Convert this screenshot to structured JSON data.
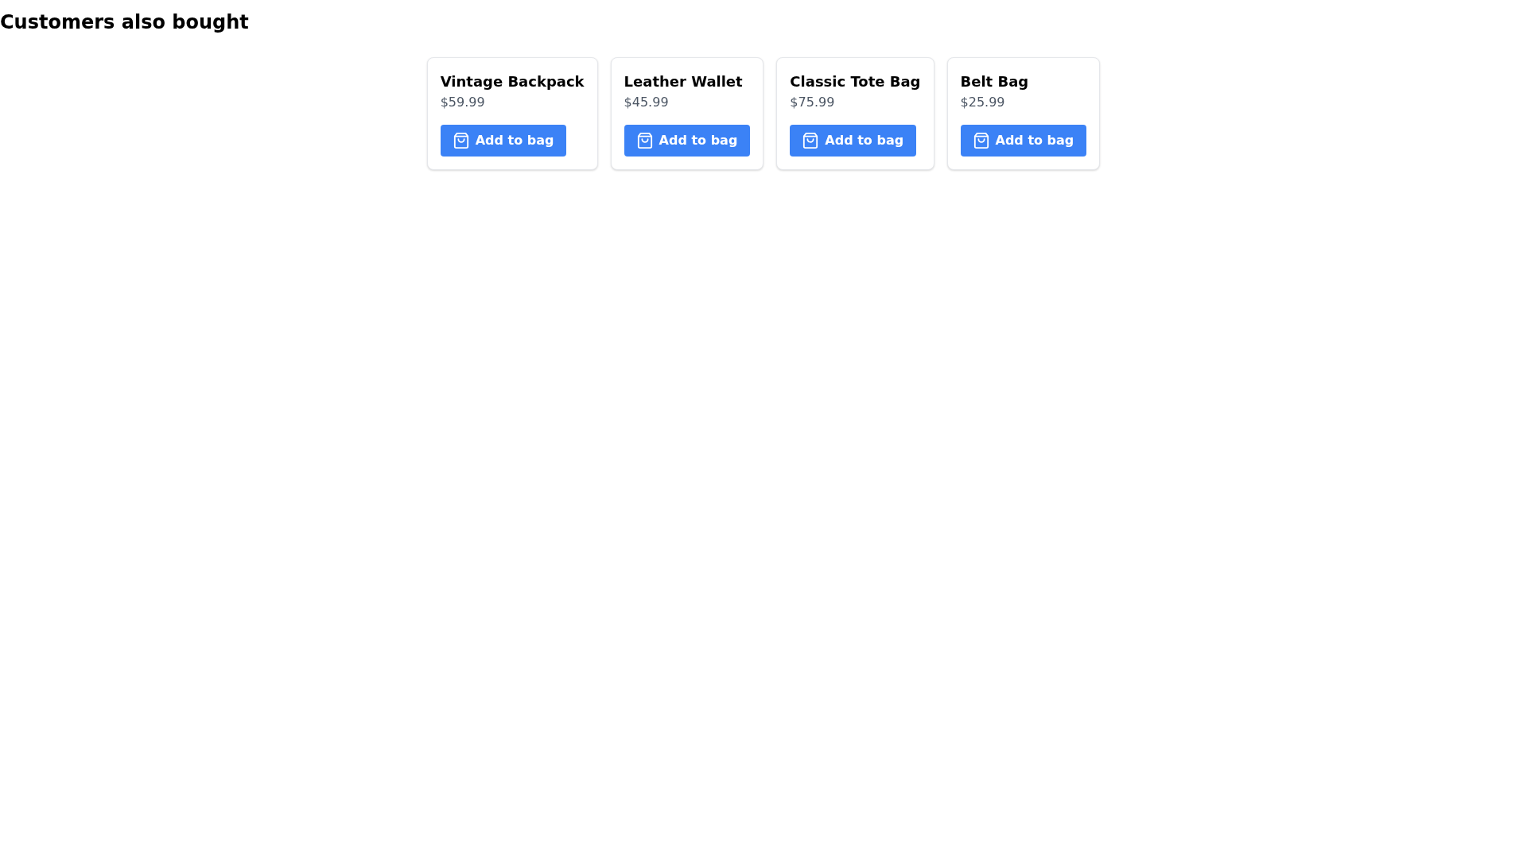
{
  "heading": "Customers also bought",
  "products": [
    {
      "name": "Vintage Backpack",
      "price": "$59.99",
      "button": "Add to bag"
    },
    {
      "name": "Leather Wallet",
      "price": "$45.99",
      "button": "Add to bag"
    },
    {
      "name": "Classic Tote Bag",
      "price": "$75.99",
      "button": "Add to bag"
    },
    {
      "name": "Belt Bag",
      "price": "$25.99",
      "button": "Add to bag"
    }
  ]
}
